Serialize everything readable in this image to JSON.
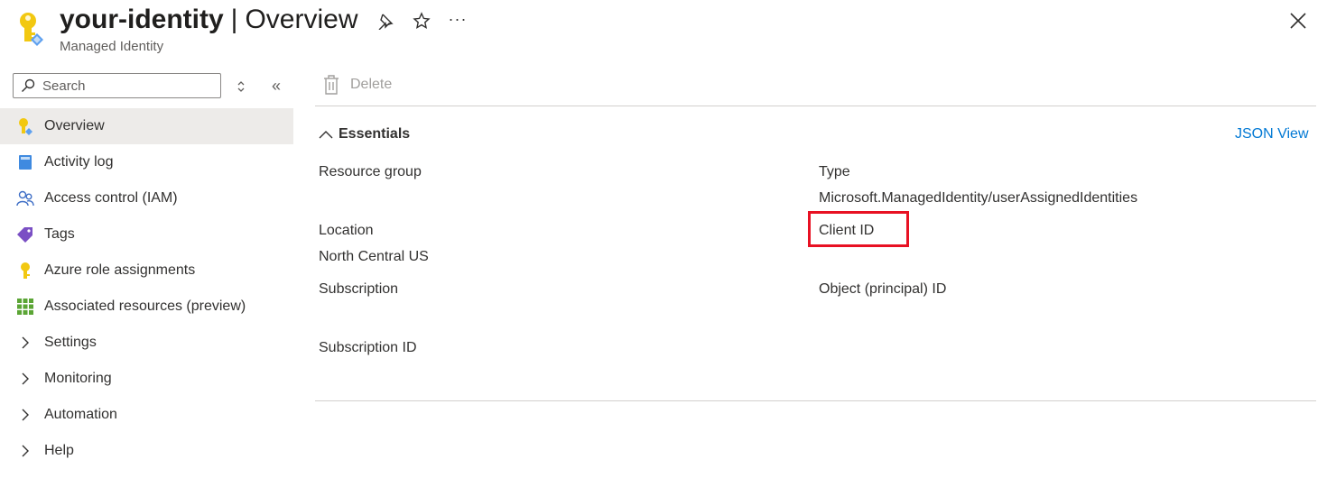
{
  "header": {
    "resource_name": "your-identity",
    "separator": "|",
    "page": "Overview",
    "subtitle": "Managed Identity",
    "icons": [
      "key-identity-icon",
      "pin-icon",
      "star-icon",
      "more-icon",
      "close-icon"
    ],
    "more_label": "···"
  },
  "sidebar": {
    "search_placeholder": "Search",
    "collapse_label": "«",
    "items": [
      {
        "label": "Overview",
        "icon": "key-identity-icon",
        "active": true
      },
      {
        "label": "Activity log",
        "icon": "activity-log-icon"
      },
      {
        "label": "Access control (IAM)",
        "icon": "people-icon"
      },
      {
        "label": "Tags",
        "icon": "tag-icon"
      },
      {
        "label": "Azure role assignments",
        "icon": "key-icon"
      },
      {
        "label": "Associated resources (preview)",
        "icon": "grid-icon"
      },
      {
        "label": "Settings",
        "icon": "chevron-right-icon"
      },
      {
        "label": "Monitoring",
        "icon": "chevron-right-icon"
      },
      {
        "label": "Automation",
        "icon": "chevron-right-icon"
      },
      {
        "label": "Help",
        "icon": "chevron-right-icon"
      }
    ]
  },
  "toolbar": {
    "delete_label": "Delete"
  },
  "essentials": {
    "title": "Essentials",
    "json_view": "JSON View",
    "left": [
      {
        "label": "Resource group",
        "value": ""
      },
      {
        "label": "Location",
        "value": "North Central US"
      },
      {
        "label": "Subscription",
        "value": ""
      },
      {
        "label": "Subscription ID",
        "value": ""
      }
    ],
    "right": [
      {
        "label": "Type",
        "value": "Microsoft.ManagedIdentity/userAssignedIdentities"
      },
      {
        "label": "Client ID",
        "value": ""
      },
      {
        "label": "Object (principal) ID",
        "value": ""
      }
    ]
  },
  "colors": {
    "accent": "#0078d4",
    "highlight": "#e81123",
    "selected_bg": "#edebe9"
  }
}
